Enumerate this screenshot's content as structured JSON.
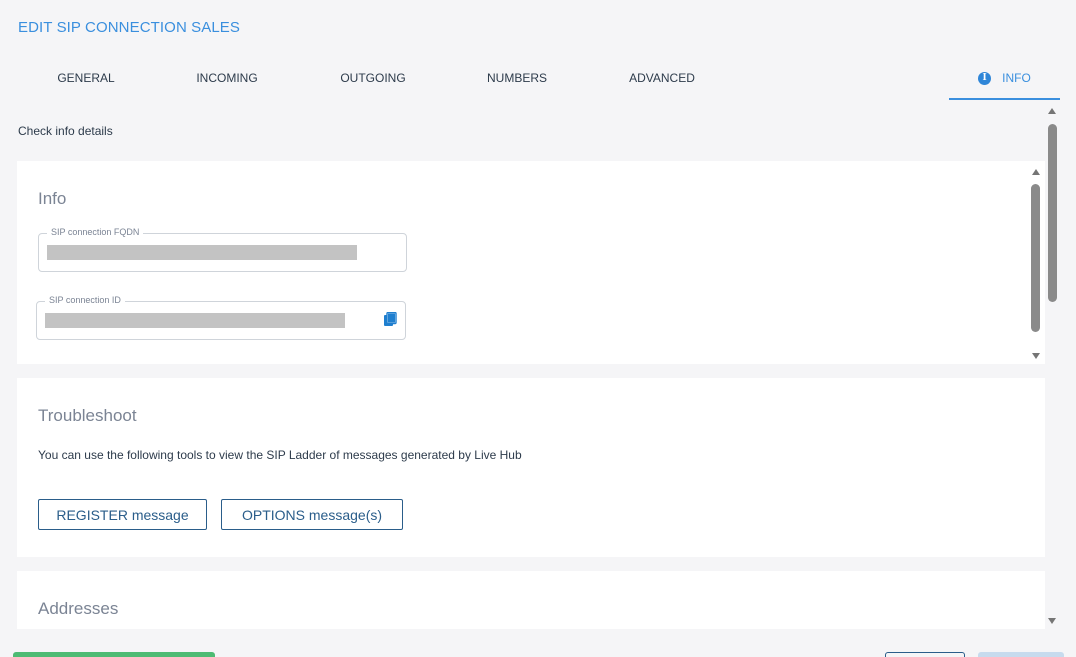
{
  "page": {
    "title": "EDIT SIP CONNECTION SALES",
    "subtitle": "Check info details"
  },
  "tabs": [
    {
      "label": "GENERAL"
    },
    {
      "label": "INCOMING"
    },
    {
      "label": "OUTGOING"
    },
    {
      "label": "NUMBERS"
    },
    {
      "label": "ADVANCED"
    },
    {
      "label": "INFO",
      "icon": "info-icon",
      "active": true
    }
  ],
  "info_card": {
    "title": "Info",
    "fqdn_label": "SIP connection FQDN",
    "id_label": "SIP connection ID",
    "copy_icon": "copy-icon"
  },
  "trouble_card": {
    "title": "Troubleshoot",
    "description": "You can use the following tools to view the SIP Ladder of messages generated by Live Hub",
    "register_button": "REGISTER message",
    "options_button": "OPTIONS message(s)"
  },
  "addresses_card": {
    "title": "Addresses"
  },
  "colors": {
    "accent": "#3a8fde",
    "button_border": "#2a5d8a",
    "footer_green": "#4dbb73"
  }
}
